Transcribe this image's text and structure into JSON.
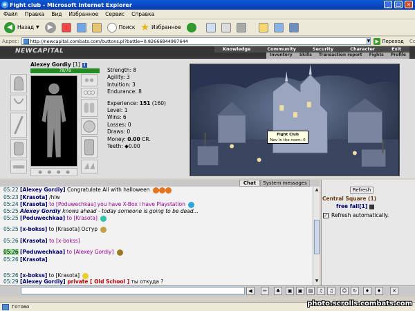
{
  "window": {
    "title": "Fight club - Microsoft Internet Explorer",
    "min_glyph": "_",
    "max_glyph": "□",
    "close_glyph": "×"
  },
  "menu": [
    "Файл",
    "Правка",
    "Вид",
    "Избранное",
    "Сервис",
    "Справка"
  ],
  "toolbar": {
    "back_label": "Назад",
    "search_label": "Поиск",
    "favorites_label": "Избранное"
  },
  "address": {
    "label": "Адрес:",
    "url": "http://newcapital.combats.com/buttons.pl?battle=0.82666844987644",
    "go_label": "Переход",
    "links_label": "Ссылки"
  },
  "game": {
    "logo": "NEWCAPITAL",
    "top_nav": [
      "Knowledge",
      "Community",
      "Security",
      "Character",
      "Exit"
    ],
    "sub_nav": [
      "Inventory",
      "Skills",
      "Transaction report",
      "Fights",
      "Profile"
    ]
  },
  "character": {
    "name": "Alexey Gordiy",
    "level_tag": "[1]",
    "info_glyph": "i",
    "hp": "78/78",
    "stats": {
      "strength": "Strength: 8",
      "agility": "Agility: 3",
      "intuition": "Intuition: 3",
      "endurance": "Endurance: 8",
      "experience_label": "Experience: ",
      "experience_value": "151",
      "experience_next": " (160)",
      "level": "Level: 1",
      "wins": "Wins: 6",
      "losses": "Losses: 0",
      "draws": "Draws: 0",
      "money_label": "Money: ",
      "money_value": "0.00",
      "money_unit": " CR.",
      "teeth": "Teeth: ◆0.00"
    }
  },
  "scene": {
    "tooltip_title": "Fight Club",
    "tooltip_text": "Nov in the room: 0"
  },
  "chat": {
    "tab_chat": "Chat",
    "tab_system": "System messages",
    "lines": [
      {
        "time": "05:22",
        "parts": [
          "[Alexey Gordiy]",
          " Congratulate All with halloween"
        ]
      },
      {
        "time": "05:23",
        "parts": [
          "[Krasota]",
          " /hlw"
        ]
      },
      {
        "time": "05:24",
        "parts": [
          "[Krasota]",
          " to ",
          "[Poduwechkaa]",
          " you have X-Box i have Playstation"
        ]
      },
      {
        "time": "05:25",
        "parts": [
          "Alexey Gordiy",
          " knows ahead - today someone is going to be dead..."
        ]
      },
      {
        "time": "05:25",
        "parts": [
          "[Poduwechkaa]",
          " to ",
          "[Krasota]"
        ]
      },
      {
        "time": "05:25",
        "parts": [
          "[x-bokss]",
          " to ",
          "[Krasota]",
          " Остур"
        ]
      },
      {
        "time": "05:26",
        "parts": [
          "[Krasota]",
          " to ",
          "[x-bokss]"
        ]
      },
      {
        "time": "05:26",
        "parts": [
          "[Poduwechkaa]",
          " to ",
          "[Alexey Gordiy]"
        ]
      },
      {
        "time": "05:26",
        "parts": [
          "[Krasota]"
        ]
      },
      {
        "time": "05:26",
        "parts": [
          "[x-bokss]",
          " to ",
          "[Krasota]"
        ]
      },
      {
        "time": "05:29",
        "parts": [
          "[Alexey Gordiy]",
          " private ",
          "[ Old School ]",
          " ты откуда ?"
        ]
      }
    ]
  },
  "room": {
    "refresh_label": "Refresh",
    "title": "Central Square (1)",
    "users": [
      "free fall",
      "[1]"
    ],
    "auto_refresh_label": "Refresh automatically.",
    "auto_refresh_checked": true,
    "check_glyph": "✓"
  },
  "statusbar": {
    "text": "Готово"
  },
  "watermark": "photo.scrolls.combats.com",
  "icons": {
    "scroll_up": "▲",
    "scroll_down": "▼",
    "dropdown": "▼",
    "back_arrow": "◀",
    "forward_arrow": "▶",
    "go_arrow": "▶",
    "input_buttons": [
      "◀",
      "✏",
      "♣",
      "▣",
      "▣",
      "▤",
      "♫",
      "♫",
      "☺",
      "↻",
      "♦",
      "♦",
      "✕"
    ]
  },
  "colors": {
    "title_bar": "#0b47c0",
    "hp_bar": "#1f8d1f",
    "chat_time_highlight": "#9be39b",
    "private": "#c00000",
    "room_title": "#6b3a12"
  }
}
